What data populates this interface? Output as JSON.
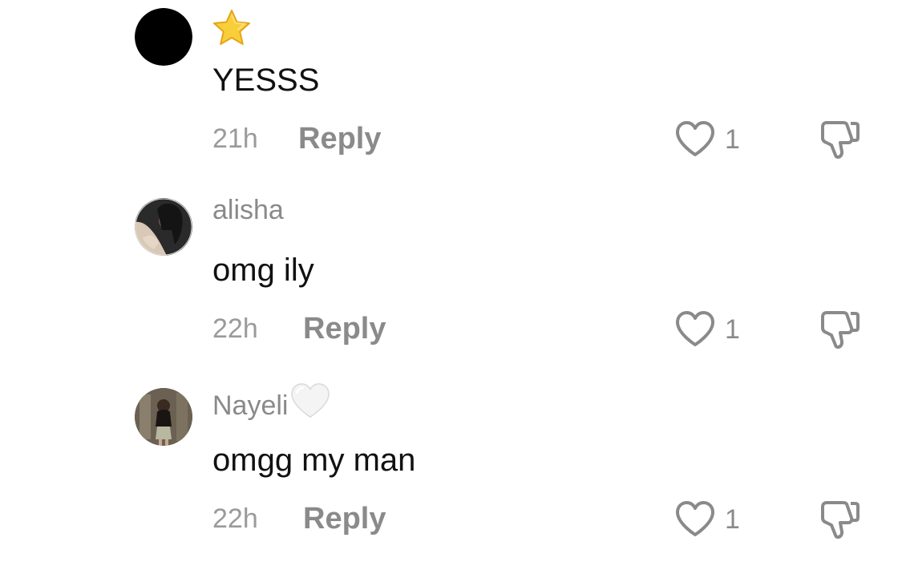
{
  "comments": [
    {
      "avatar": "black-circle-avatar",
      "username": "",
      "username_icon": "star-icon",
      "text": "YESSS",
      "time": "21h",
      "reply_label": "Reply",
      "likes": "1"
    },
    {
      "avatar": "photo-avatar",
      "username": "alisha",
      "text": "omg ily",
      "time": "22h",
      "reply_label": "Reply",
      "likes": "1"
    },
    {
      "avatar": "photo-avatar",
      "username": "Nayeli",
      "username_icon": "white-heart-icon",
      "text": "omgg my man",
      "time": "22h",
      "reply_label": "Reply",
      "likes": "1"
    }
  ],
  "colors": {
    "text": "#111111",
    "muted": "#8a8a8a",
    "star": "#f6c21c",
    "icon_stroke": "#8a8a8a"
  }
}
